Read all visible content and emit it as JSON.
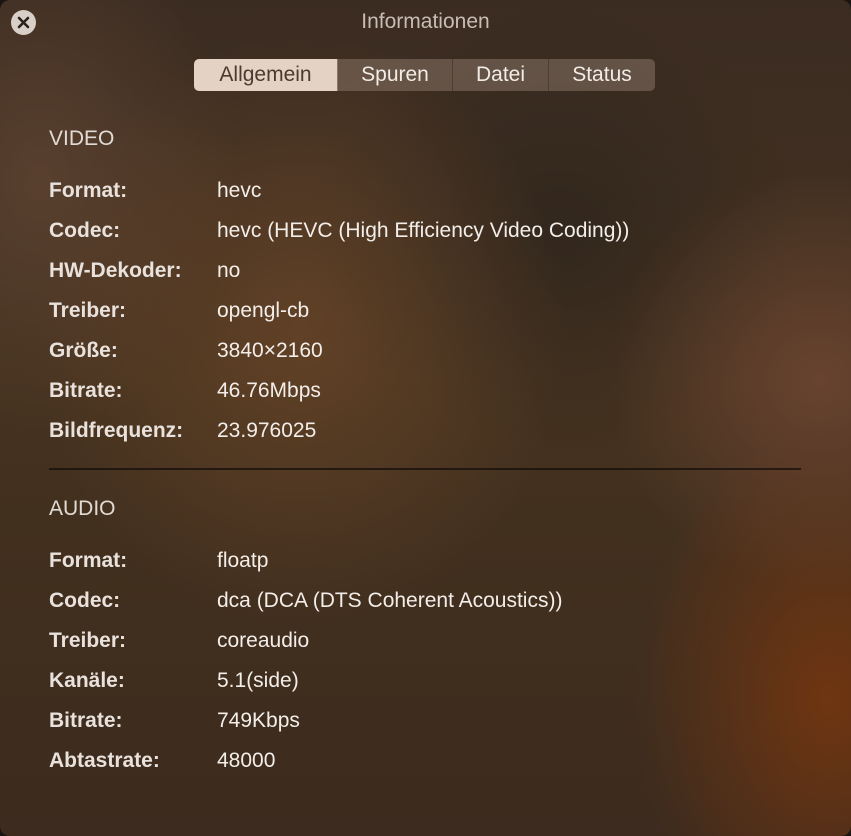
{
  "window": {
    "title": "Informationen"
  },
  "tabs": [
    {
      "label": "Allgemein",
      "active": true
    },
    {
      "label": "Spuren",
      "active": false
    },
    {
      "label": "Datei",
      "active": false
    },
    {
      "label": "Status",
      "active": false
    }
  ],
  "video": {
    "heading": "VIDEO",
    "rows": [
      {
        "label": "Format:",
        "value": "hevc"
      },
      {
        "label": "Codec:",
        "value": "hevc (HEVC (High Efficiency Video Coding))"
      },
      {
        "label": "HW-Dekoder:",
        "value": "no"
      },
      {
        "label": "Treiber:",
        "value": "opengl-cb"
      },
      {
        "label": "Größe:",
        "value": "3840×2160"
      },
      {
        "label": "Bitrate:",
        "value": "46.76Mbps"
      },
      {
        "label": "Bildfrequenz:",
        "value": "23.976025"
      }
    ]
  },
  "audio": {
    "heading": "AUDIO",
    "rows": [
      {
        "label": "Format:",
        "value": "floatp"
      },
      {
        "label": "Codec:",
        "value": "dca (DCA (DTS Coherent Acoustics))"
      },
      {
        "label": "Treiber:",
        "value": "coreaudio"
      },
      {
        "label": "Kanäle:",
        "value": "5.1(side)"
      },
      {
        "label": "Bitrate:",
        "value": "749Kbps"
      },
      {
        "label": "Abtastrate:",
        "value": "48000"
      }
    ]
  },
  "icons": {
    "close": "close-icon"
  },
  "colors": {
    "active_tab_bg": "#e4d2c5",
    "text": "#f1ece7"
  }
}
